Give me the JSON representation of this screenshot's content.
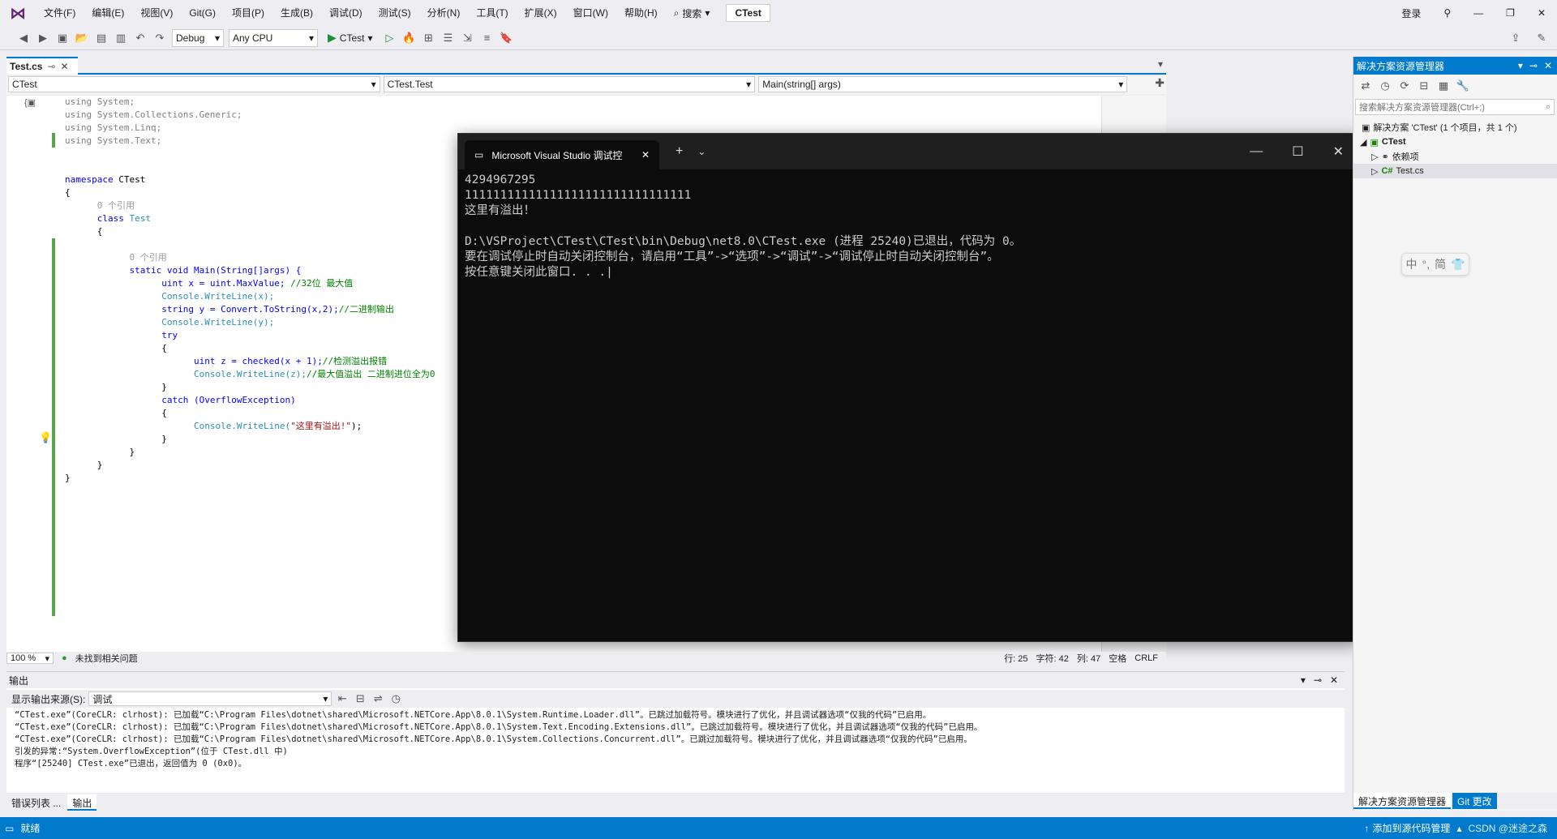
{
  "menubar": {
    "items": [
      "文件(F)",
      "编辑(E)",
      "视图(V)",
      "Git(G)",
      "项目(P)",
      "生成(B)",
      "调试(D)",
      "测试(S)",
      "分析(N)",
      "工具(T)",
      "扩展(X)",
      "窗口(W)",
      "帮助(H)"
    ],
    "search": "搜索",
    "solution_title": "CTest",
    "login": "登录"
  },
  "toolbar": {
    "config": "Debug",
    "platform": "Any CPU",
    "run_target": "CTest"
  },
  "editor": {
    "tab": "Test.cs",
    "nav": [
      "CTest",
      "CTest.Test",
      "Main(string[] args)"
    ],
    "zoom": "100 %",
    "issues": "未找到相关问题",
    "position": {
      "line": "行: 25",
      "char": "字符: 42",
      "col": "列: 47",
      "space": "空格",
      "eol": "CRLF"
    }
  },
  "code": {
    "l1": "using System;",
    "l2": "using System.Collections.Generic;",
    "l3": "using System.Linq;",
    "l4": "using System.Text;",
    "ns_kw": "namespace",
    "ns": "CTest",
    "ref0": "0 个引用",
    "class_kw": "class",
    "class": "Test",
    "ref1": "0 个引用",
    "main_sig": "static void Main(String[]args) {",
    "l_uint": "uint x = uint.MaxValue;",
    "c_uint": "//32位 最大值",
    "l_wl1": "Console.WriteLine(x);",
    "l_str": "string y = Convert.ToString(x,2);",
    "c_str": "//二进制输出",
    "l_wl2": "Console.WriteLine(y);",
    "try": "try",
    "l_z": "uint z = checked(x + 1);",
    "c_z": "//检测溢出报错",
    "l_wl3": "Console.WriteLine(z);",
    "c_wl3": "//最大值溢出 二进制进位全为0",
    "catch": "catch (OverflowException)",
    "l_wl4a": "Console.WriteLine(",
    "l_wl4s": "\"这里有溢出!\"",
    "l_wl4b": ");"
  },
  "console": {
    "title": "Microsoft Visual Studio 调试控",
    "lines": [
      "4294967295",
      "11111111111111111111111111111111",
      "这里有溢出！",
      "",
      "D:\\VSProject\\CTest\\CTest\\bin\\Debug\\net8.0\\CTest.exe (进程 25240)已退出，代码为 0。",
      "要在调试停止时自动关闭控制台，请启用“工具”->“选项”->“调试”->“调试停止时自动关闭控制台”。",
      "按任意键关闭此窗口. . ."
    ]
  },
  "output": {
    "title": "输出",
    "source_label": "显示输出来源(S):",
    "source": "调试",
    "lines": [
      "“CTest.exe”(CoreCLR: clrhost): 已加载“C:\\Program Files\\dotnet\\shared\\Microsoft.NETCore.App\\8.0.1\\System.Runtime.Loader.dll”。已跳过加载符号。模块进行了优化，并且调试器选项“仅我的代码”已启用。",
      "“CTest.exe”(CoreCLR: clrhost): 已加载“C:\\Program Files\\dotnet\\shared\\Microsoft.NETCore.App\\8.0.1\\System.Text.Encoding.Extensions.dll”。已跳过加载符号。模块进行了优化，并且调试器选项“仅我的代码”已启用。",
      "“CTest.exe”(CoreCLR: clrhost): 已加载“C:\\Program Files\\dotnet\\shared\\Microsoft.NETCore.App\\8.0.1\\System.Collections.Concurrent.dll”。已跳过加载符号。模块进行了优化，并且调试器选项“仅我的代码”已启用。",
      "引发的异常:“System.OverflowException”(位于 CTest.dll 中)",
      "程序“[25240] CTest.exe”已退出，返回值为 0 (0x0)。"
    ]
  },
  "bottom_tabs": [
    "错误列表 ...",
    "输出"
  ],
  "solution_explorer": {
    "title": "解决方案资源管理器",
    "search_placeholder": "搜索解决方案资源管理器(Ctrl+;)",
    "solution": "解决方案 'CTest' (1 个项目，共 1 个)",
    "project": "CTest",
    "deps": "依赖项",
    "file": "Test.cs",
    "tabs": [
      "解决方案资源管理器",
      "Git 更改"
    ]
  },
  "ime": {
    "a": "中",
    "b": "°,",
    "c": "简"
  },
  "statusbar": {
    "ready": "就绪",
    "add_source": "添加到源代码管理",
    "watermark": "CSDN @迷途之森"
  }
}
